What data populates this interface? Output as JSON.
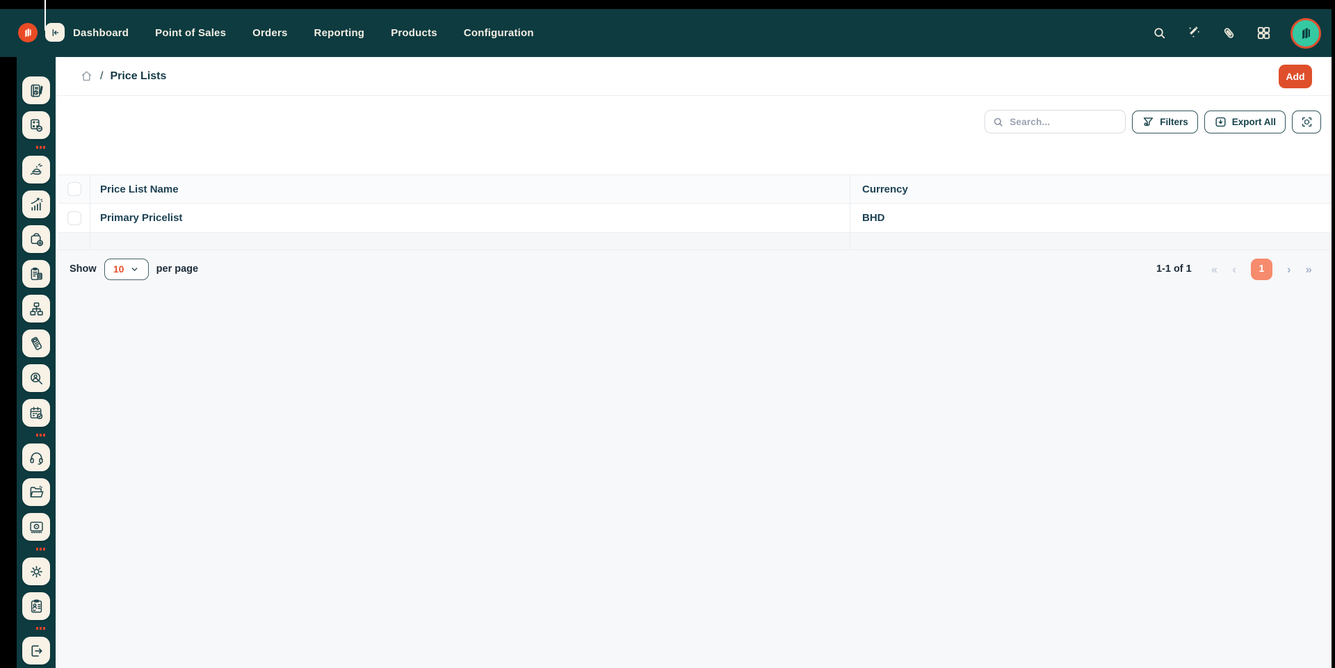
{
  "topnav": {
    "items": [
      {
        "label": "Dashboard"
      },
      {
        "label": "Point of Sales"
      },
      {
        "label": "Orders"
      },
      {
        "label": "Reporting"
      },
      {
        "label": "Products"
      },
      {
        "label": "Configuration"
      }
    ],
    "right_icons": [
      "search-icon",
      "magic-wand-icon",
      "attachment-icon",
      "apps-grid-icon",
      "user-avatar"
    ]
  },
  "breadcrumb": {
    "home_icon": "home-icon",
    "separator": "/",
    "current": "Price Lists"
  },
  "header_actions": {
    "add_label": "Add"
  },
  "toolbar": {
    "search_placeholder": "Search...",
    "filters_label": "Filters",
    "export_label": "Export All",
    "fullscreen_icon": "fullscreen-icon"
  },
  "table": {
    "columns": [
      "Price List Name",
      "Currency"
    ],
    "rows": [
      {
        "name": "Primary Pricelist",
        "currency": "BHD"
      }
    ]
  },
  "pagination": {
    "show_label": "Show",
    "page_size": "10",
    "per_page_label": "per page",
    "range_label": "1-1 of 1",
    "first_icon": "«",
    "prev_icon": "‹",
    "current_page": "1",
    "next_icon": "›",
    "last_icon": "»"
  },
  "sidebar": {
    "items": [
      {
        "icon": "daily-report-icon"
      },
      {
        "icon": "calculator-coins-icon"
      },
      {
        "icon": "divider-dash"
      },
      {
        "icon": "food-service-icon"
      },
      {
        "icon": "sales-growth-icon"
      },
      {
        "icon": "add-product-icon"
      },
      {
        "icon": "billing-clipboard-icon"
      },
      {
        "icon": "hierarchy-icon"
      },
      {
        "icon": "pos-terminal-icon"
      },
      {
        "icon": "customer-search-icon"
      },
      {
        "icon": "calendar-icon"
      },
      {
        "icon": "divider-dash"
      },
      {
        "icon": "support-icon"
      },
      {
        "icon": "documents-icon"
      },
      {
        "icon": "display-icon"
      },
      {
        "icon": "divider-dash"
      },
      {
        "icon": "settings-icon"
      },
      {
        "icon": "staff-icon"
      },
      {
        "icon": "divider-dash"
      },
      {
        "icon": "logout-icon"
      }
    ]
  },
  "colors": {
    "topbar_teal": "#0d3b40",
    "accent_orange": "#df4f2b",
    "logo_orange": "#ea4b26",
    "active_page_salmon": "#f68b6d",
    "tile_cream": "#f7f1e6",
    "avatar_green": "#35c9a2",
    "text_dark_teal": "#1d4254"
  }
}
